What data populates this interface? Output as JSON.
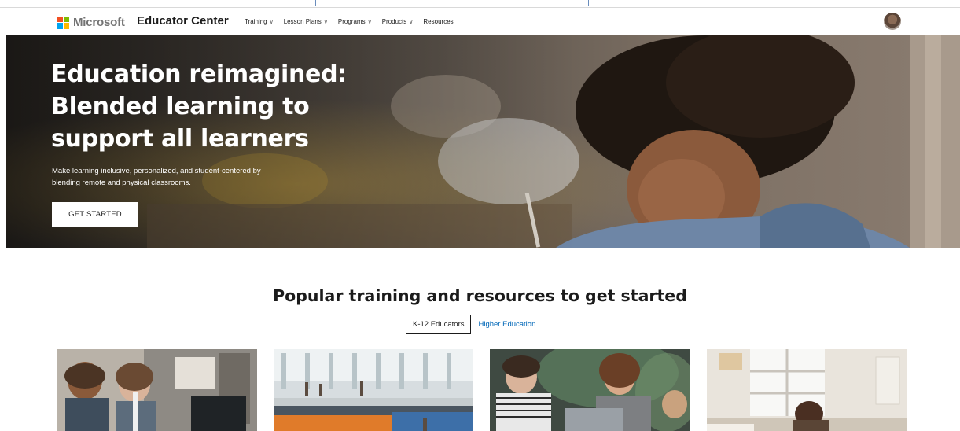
{
  "colors": {
    "ms_red": "#f25022",
    "ms_green": "#7fba00",
    "ms_blue": "#00a4ef",
    "ms_yellow": "#ffb900",
    "link_blue": "#0067b8",
    "text_dark": "#1b1b1b"
  },
  "header": {
    "brand": "Microsoft",
    "site_name": "Educator Center",
    "nav": [
      {
        "label": "Training",
        "has_dropdown": true
      },
      {
        "label": "Lesson Plans",
        "has_dropdown": true
      },
      {
        "label": "Programs",
        "has_dropdown": true
      },
      {
        "label": "Products",
        "has_dropdown": true
      },
      {
        "label": "Resources",
        "has_dropdown": false
      }
    ],
    "chevron_glyph": "∨",
    "avatar_icon": "user-avatar-icon"
  },
  "hero": {
    "title_lines": [
      "Education reimagined:",
      "Blended learning to",
      "support all learners"
    ],
    "subtitle_lines": [
      "Make learning inclusive, personalized, and student-centered by",
      "blending remote and physical classrooms."
    ],
    "cta_label": "GET STARTED"
  },
  "section": {
    "title": "Popular training and resources to get started",
    "tabs": [
      {
        "label": "K-12 Educators",
        "active": true
      },
      {
        "label": "Higher Education",
        "active": false
      }
    ]
  },
  "cards": [
    {
      "image": "classroom-students-laptop-image"
    },
    {
      "image": "school-atrium-image"
    },
    {
      "image": "students-laptop-study-image"
    },
    {
      "image": "student-writing-home-image"
    }
  ]
}
